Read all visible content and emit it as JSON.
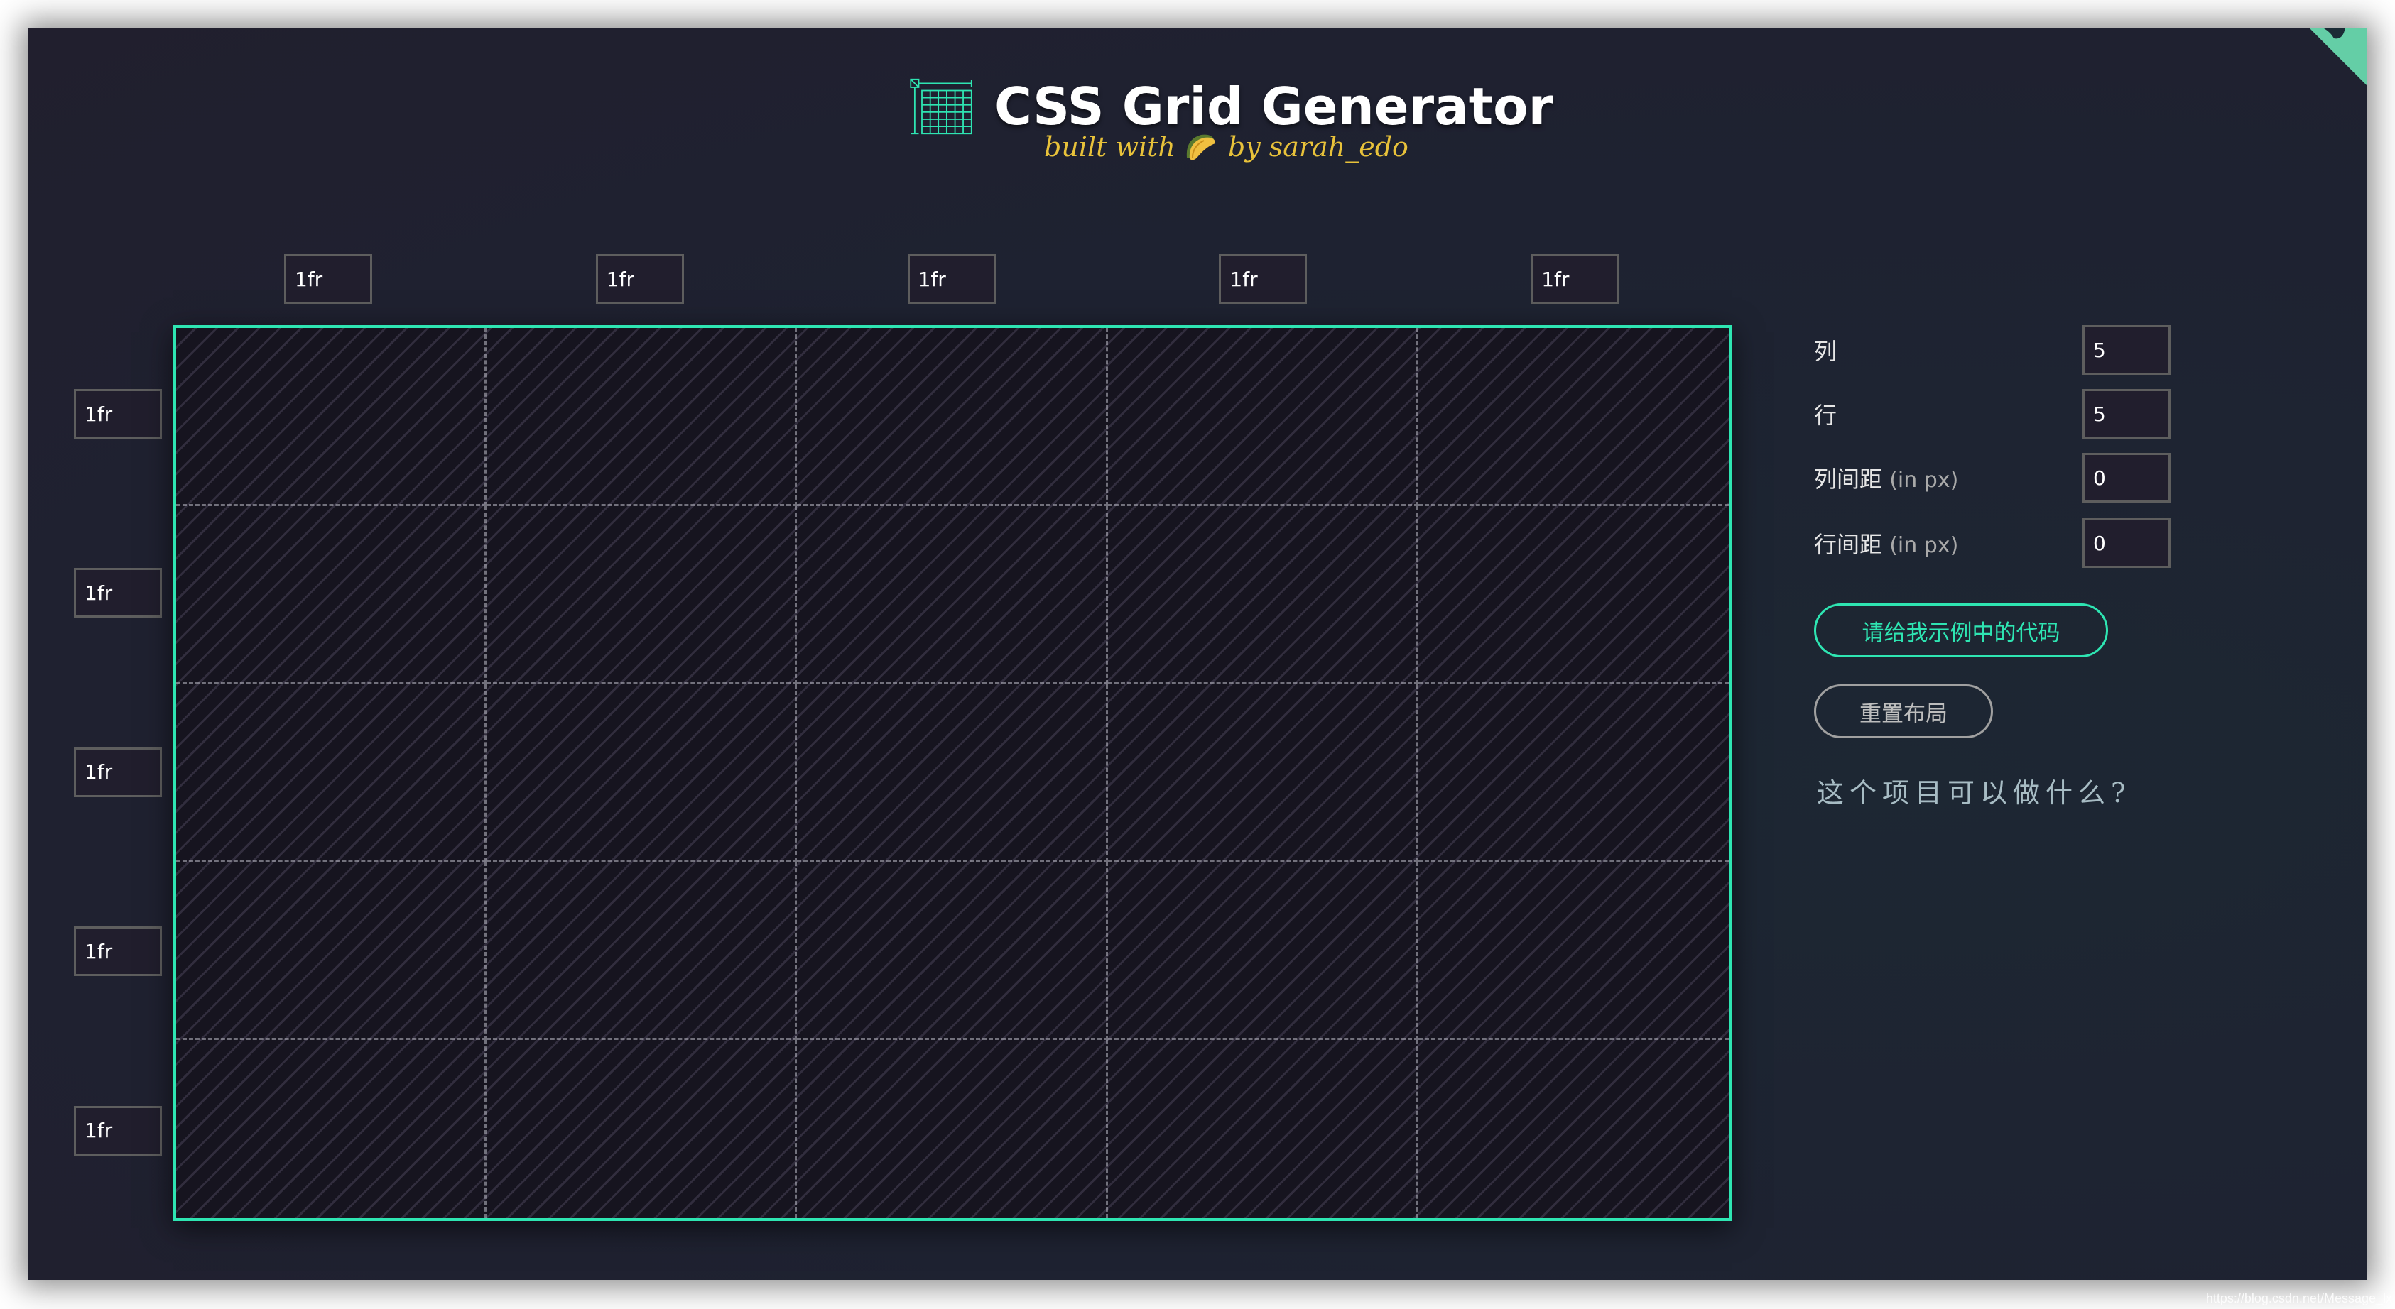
{
  "app": {
    "title": "CSS Grid Generator",
    "tagline_before": "built with",
    "tagline_after": "by sarah_edo",
    "tagline_icon": "taco-icon"
  },
  "colors": {
    "accent": "#2ee5b2",
    "tagline": "#e8c23a",
    "background": "#1e2231",
    "input_bg": "#211e2d",
    "input_border": "#5e5e5e"
  },
  "grid": {
    "columns": [
      "1fr",
      "1fr",
      "1fr",
      "1fr",
      "1fr"
    ],
    "rows": [
      "1fr",
      "1fr",
      "1fr",
      "1fr",
      "1fr"
    ]
  },
  "controls": {
    "columns_label": "列",
    "columns_value": "5",
    "rows_label": "行",
    "rows_value": "5",
    "column_gap_label": "列间距",
    "column_gap_unit": "(in px)",
    "column_gap_value": "0",
    "row_gap_label": "行间距",
    "row_gap_unit": "(in px)",
    "row_gap_value": "0",
    "code_button": "请给我示例中的代码",
    "reset_button": "重置布局",
    "about_link": "这个项目可以做什么?"
  },
  "watermark": "https://blog.csdn.net/Message_lx"
}
